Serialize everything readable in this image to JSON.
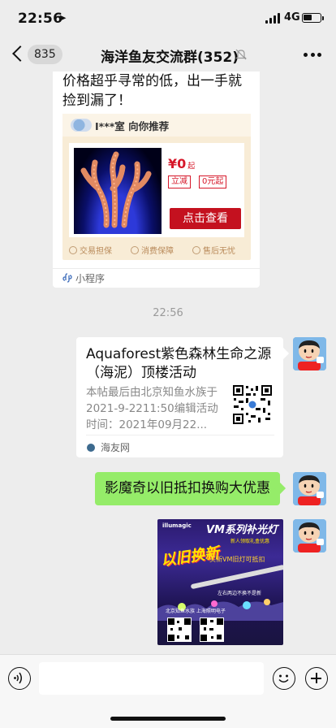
{
  "status_bar": {
    "time": "22:56",
    "network": "4G",
    "battery_level": 0.5
  },
  "nav": {
    "unread_count": "835",
    "title": "海洋鱼友交流群(352)"
  },
  "messages": {
    "mini_program": {
      "lead_text": "价格超乎寻常的低，出一手就捡到漏了！",
      "shop_name": "I***室 向你推荐",
      "price": "¥0",
      "price_unit": "起",
      "tag_1": "立减",
      "tag_2": "0元起",
      "button_label": "点击查看",
      "assurances": [
        "交易担保",
        "消费保障",
        "售后无忧"
      ],
      "source_label": "小程序"
    },
    "timestamp": "22:56",
    "link_card": {
      "title": "Aquaforest紫色森林生命之源（海泥）顶楼活动",
      "description": "本帖最后由北京知鱼水族于2021-9-2211:50编辑活动时间：2021年09月22...",
      "source_label": "海友网"
    },
    "text_message": "影魔奇以旧抵扣换购大优惠",
    "poster": {
      "brand": "illumagic",
      "title": "VM系列补光灯",
      "subtitle": "新人领取礼盒优惠",
      "swap_label": "以旧换新",
      "offer": "买新VM旧灯可抵扣",
      "middle_text": "左右两边不换不是新",
      "shops": "北京知鱼水族  上海照明电子"
    }
  },
  "input_bar": {
    "placeholder": ""
  },
  "colors": {
    "chat_background": "#ededed",
    "outgoing_bubble": "#95ec69",
    "price_red": "#d6182a",
    "button_red": "#c4111f"
  }
}
